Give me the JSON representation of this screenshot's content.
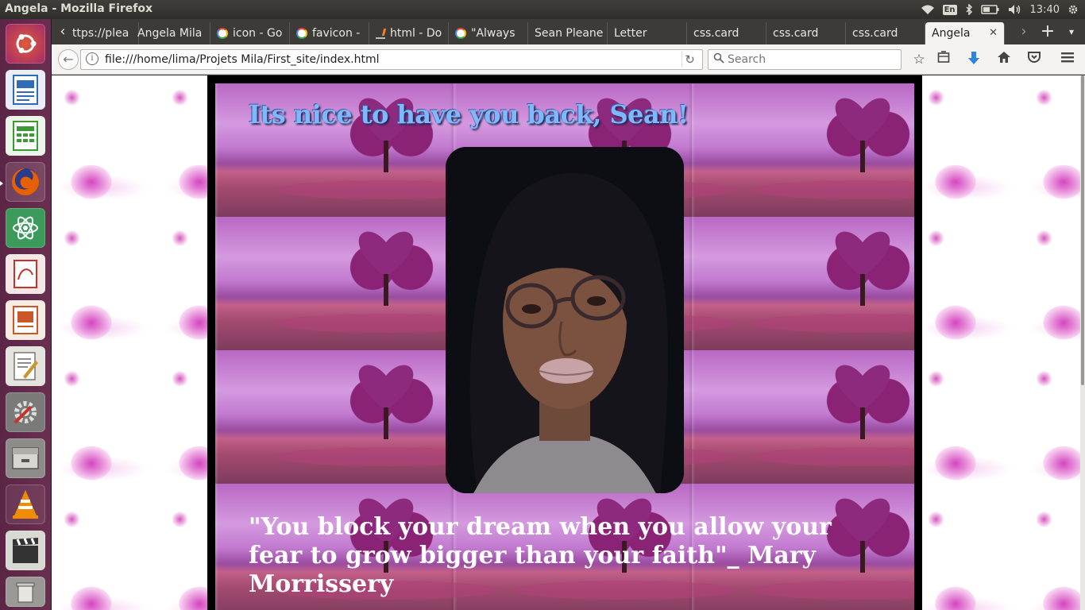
{
  "window": {
    "title": "Angela - Mozilla Firefox"
  },
  "system_tray": {
    "keyboard_layout": "En",
    "clock": "13:40"
  },
  "launcher": {
    "apps": [
      {
        "name": "ubuntu-dash",
        "color": "#d8442c"
      },
      {
        "name": "libreoffice-writer",
        "color": "#2e6db4"
      },
      {
        "name": "libreoffice-calc",
        "color": "#3c9a36"
      },
      {
        "name": "firefox",
        "color": "#e66000"
      },
      {
        "name": "atom",
        "color": "#3c9a5a"
      },
      {
        "name": "document-viewer",
        "color": "#c8322a"
      },
      {
        "name": "libreoffice-impress",
        "color": "#c8582a"
      },
      {
        "name": "text-editor",
        "color": "#d9d9d3"
      },
      {
        "name": "system-settings",
        "color": "#8a8a88"
      },
      {
        "name": "file-archive",
        "color": "#9b9b96"
      },
      {
        "name": "vlc",
        "color": "#f08c00"
      },
      {
        "name": "video-editor",
        "color": "#3a3a3a"
      },
      {
        "name": "trash",
        "color": "#b8b8b4"
      }
    ]
  },
  "tabs": [
    {
      "label": "ttps://plea",
      "icon": ""
    },
    {
      "label": "Angela Mila",
      "icon": ""
    },
    {
      "label": "icon - Go",
      "icon": "google"
    },
    {
      "label": "favicon -",
      "icon": "google"
    },
    {
      "label": "html - Do",
      "icon": "stackoverflow"
    },
    {
      "label": "\"Always",
      "icon": "google"
    },
    {
      "label": "Sean Pleane",
      "icon": ""
    },
    {
      "label": "Letter",
      "icon": ""
    },
    {
      "label": "css.card",
      "icon": ""
    },
    {
      "label": "css.card",
      "icon": ""
    },
    {
      "label": "css.card",
      "icon": ""
    },
    {
      "label": "Angela",
      "icon": "",
      "active": true
    }
  ],
  "toolbar": {
    "url": "file:///home/lima/Projets Mila/First_site/index.html",
    "search_placeholder": "Search"
  },
  "page": {
    "greeting": "Its nice to have you back, Sean!",
    "quote": "\"You block your dream when you allow your fear to grow bigger than your faith\"_ Mary Morrissery"
  }
}
